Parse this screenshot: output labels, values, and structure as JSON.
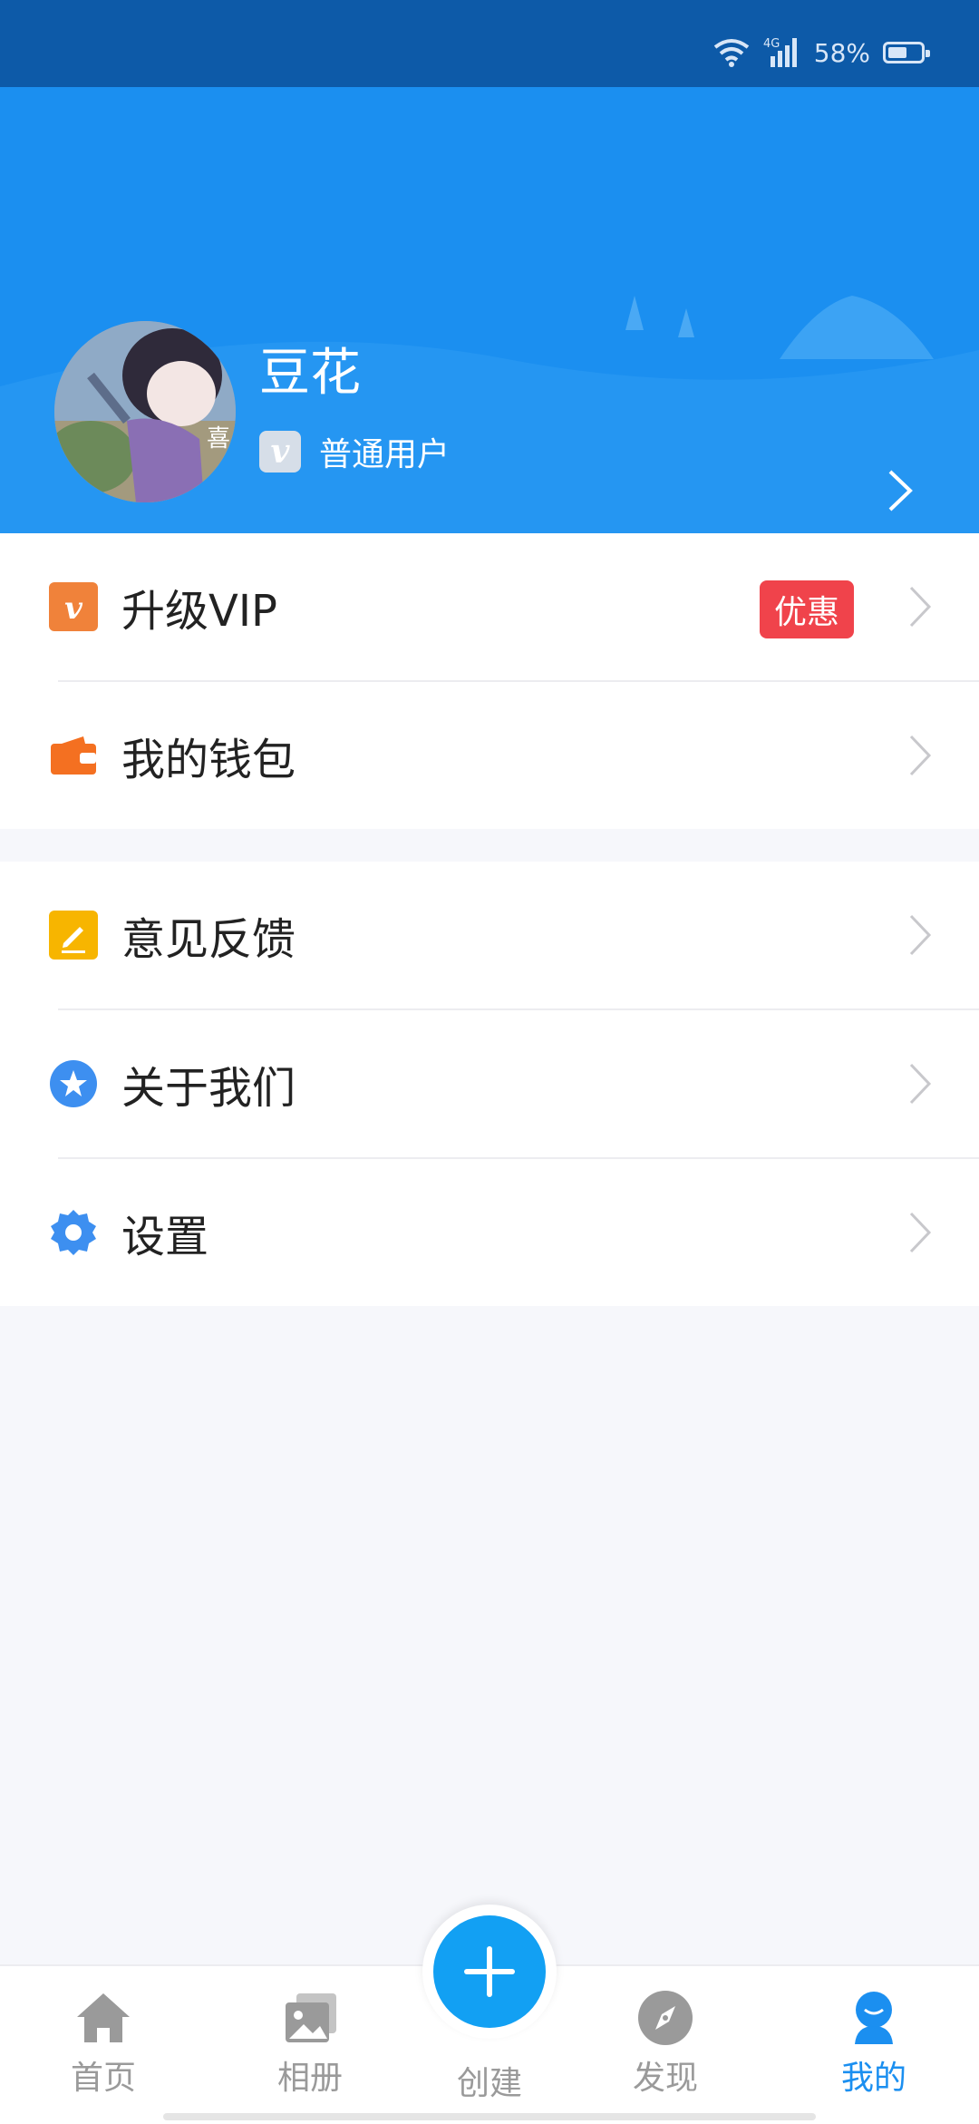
{
  "status_bar": {
    "network": "4G",
    "battery_percent": "58%",
    "battery_level": 0.58
  },
  "profile": {
    "name": "豆花",
    "member_badge": "v",
    "member_level": "普通用户",
    "avatar_caption": "喜"
  },
  "menu_primary": [
    {
      "label": "升级VIP",
      "icon": "vip-icon",
      "icon_color": "#f0823a",
      "badge": "优惠"
    },
    {
      "label": "我的钱包",
      "icon": "wallet-icon",
      "icon_color": "#f47021"
    }
  ],
  "menu_secondary": [
    {
      "label": "意见反馈",
      "icon": "feedback-edit-icon",
      "icon_color": "#f7b500"
    },
    {
      "label": "关于我们",
      "icon": "star-icon",
      "icon_color": "#3d8ff0"
    },
    {
      "label": "设置",
      "icon": "gear-icon",
      "icon_color": "#3d8ff0"
    }
  ],
  "tabbar": {
    "items": [
      {
        "label": "首页",
        "icon": "home-icon"
      },
      {
        "label": "相册",
        "icon": "album-icon"
      },
      {
        "label": "创建",
        "icon": "plus-icon"
      },
      {
        "label": "发现",
        "icon": "compass-icon"
      },
      {
        "label": "我的",
        "icon": "user-icon",
        "active": true
      }
    ]
  },
  "colors": {
    "header": "#1b8ff0",
    "status_bar": "#0d5aa8",
    "active_tab": "#1b8ff0",
    "badge": "#f0434b"
  }
}
